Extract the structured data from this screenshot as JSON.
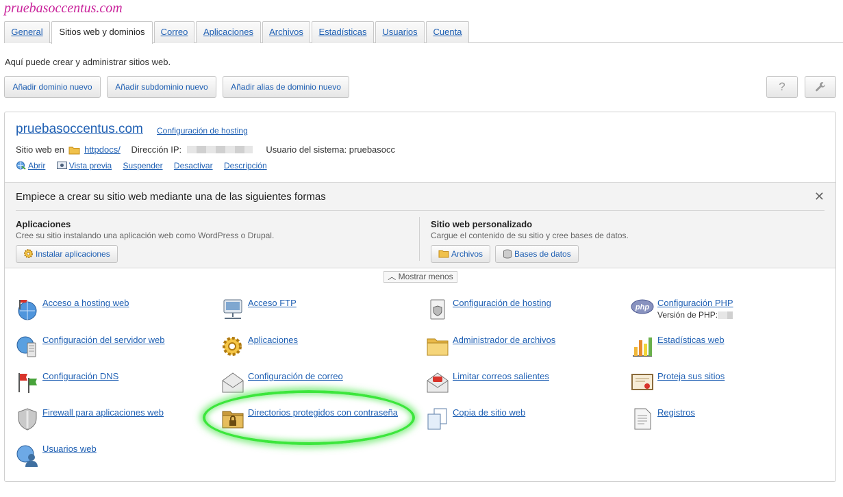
{
  "header": {
    "site_title": "pruebasoccentus.com"
  },
  "tabs": [
    {
      "label": "General"
    },
    {
      "label": "Sitios web y dominios"
    },
    {
      "label": "Correo"
    },
    {
      "label": "Aplicaciones"
    },
    {
      "label": "Archivos"
    },
    {
      "label": "Estadísticas"
    },
    {
      "label": "Usuarios"
    },
    {
      "label": "Cuenta"
    }
  ],
  "active_tab": "Sitios web y dominios",
  "intro": "Aquí puede crear y administrar sitios web.",
  "toolbar": {
    "add_domain": "Añadir dominio nuevo",
    "add_subdomain": "Añadir subdominio nuevo",
    "add_alias": "Añadir alias de dominio nuevo",
    "help_icon": "?",
    "settings_icon": "wrench-icon"
  },
  "domain": {
    "name": "pruebasoccentus.com",
    "hosting_link": "Configuración de hosting",
    "site_at_label": "Sitio web en",
    "docroot": "httpdocs/",
    "ip_label": "Dirección IP:",
    "system_user": "Usuario del sistema: pruebasocc",
    "actions": {
      "open": "Abrir",
      "preview": "Vista previa",
      "suspend": "Suspender",
      "disable": "Desactivar",
      "description": "Descripción"
    }
  },
  "start": {
    "title": "Empiece a crear su sitio web mediante una de las siguientes formas",
    "close": "✕",
    "apps_head": "Aplicaciones",
    "apps_desc": "Cree su sitio instalando una aplicación web como WordPress o Drupal.",
    "apps_btn": "Instalar aplicaciones",
    "custom_head": "Sitio web personalizado",
    "custom_desc": "Cargue el contenido de su sitio y cree bases de datos.",
    "files_btn": "Archivos",
    "db_btn": "Bases de datos"
  },
  "show_less": "Mostrar menos",
  "tools": {
    "hosting_access": "Acceso a hosting web",
    "ftp": "Acceso FTP",
    "hosting_settings": "Configuración de hosting",
    "php_settings": "Configuración PHP",
    "php_version_label": "Versión de PHP:",
    "web_server": "Configuración del servidor web",
    "applications": "Aplicaciones",
    "file_manager": "Administrador de archivos",
    "web_stats": "Estadísticas web",
    "dns": "Configuración DNS",
    "mail_settings": "Configuración de correo",
    "limit_mail": "Limitar correos salientes",
    "protect": "Proteja sus sitios",
    "firewall": "Firewall para aplicaciones web",
    "protected_dirs": "Directorios protegidos con contraseña",
    "backup": "Copia de sitio web",
    "logs": "Registros",
    "web_users": "Usuarios web"
  },
  "colors": {
    "link": "#1e5fb3",
    "brand": "#c9239b",
    "highlight": "#3ce63c"
  }
}
